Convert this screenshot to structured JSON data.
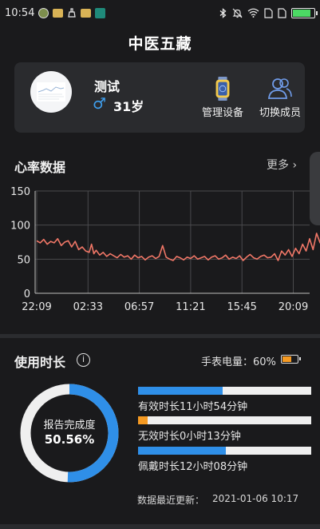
{
  "status_bar": {
    "time": "10:54",
    "battery_level": 0.85
  },
  "page_title": "中医五藏",
  "profile": {
    "name": "测试",
    "gender_symbol": "♂",
    "age": "31岁",
    "manage_device_label": "管理设备",
    "switch_member_label": "切换成员"
  },
  "heart_rate": {
    "title": "心率数据",
    "more_label": "更多"
  },
  "chart_data": {
    "type": "line",
    "title": "",
    "xlabel": "",
    "ylabel": "",
    "ylim": [
      0,
      150
    ],
    "yticks": [
      "0",
      "50",
      "100",
      "150"
    ],
    "xticks": [
      "22:09",
      "02:33",
      "06:57",
      "11:21",
      "15:45",
      "20:09"
    ],
    "grid": true,
    "series": [
      {
        "color": "#f07767",
        "x": [
          0,
          0.3,
          0.6,
          0.9,
          1.2,
          1.5,
          1.8,
          2.1,
          2.4,
          2.7,
          3.0,
          3.3,
          3.6,
          3.9,
          4.2,
          4.5,
          4.7,
          4.9,
          5.1,
          5.4,
          5.7,
          6.0,
          6.3,
          6.6,
          6.9,
          7.2,
          7.5,
          7.8,
          8.1,
          8.4,
          8.7,
          9.0,
          9.3,
          9.6,
          9.9,
          10.2,
          10.5,
          10.8,
          11.1,
          11.4,
          11.7,
          12.0,
          12.3,
          12.6,
          12.9,
          13.2,
          13.5,
          13.8,
          14.1,
          14.4,
          14.7,
          15.0,
          15.3,
          15.6,
          15.9,
          16.2,
          16.5,
          16.8,
          17.1,
          17.4,
          17.7,
          18.0,
          18.3,
          18.6,
          18.9,
          19.2,
          19.5,
          19.8,
          20.1,
          20.4,
          20.7,
          21.0,
          21.3,
          21.6,
          21.9,
          22.2,
          22.5,
          22.8,
          23.1,
          23.4,
          23.7,
          24.0,
          24.3,
          24.6,
          24.9,
          25.2,
          25.5,
          25.8,
          26.1,
          26.4,
          26.7
        ],
        "y": [
          77,
          74,
          79,
          72,
          76,
          74,
          80,
          70,
          75,
          77,
          68,
          76,
          64,
          68,
          62,
          60,
          72,
          58,
          63,
          56,
          60,
          54,
          58,
          55,
          52,
          57,
          53,
          55,
          50,
          56,
          52,
          54,
          49,
          53,
          55,
          51,
          54,
          70,
          53,
          50,
          48,
          54,
          52,
          49,
          53,
          51,
          55,
          50,
          52,
          54,
          49,
          53,
          55,
          50,
          52,
          56,
          50,
          53,
          51,
          55,
          48,
          53,
          57,
          52,
          50,
          54,
          56,
          52,
          53,
          58,
          48,
          62,
          56,
          64,
          54,
          66,
          58,
          72,
          62,
          80,
          64,
          88,
          74,
          97,
          78,
          104,
          88,
          94,
          82,
          96,
          88
        ]
      }
    ]
  },
  "usage": {
    "title": "使用时长",
    "watch_battery_label": "手表电量：60%",
    "watch_battery_level": 0.6,
    "completion_label": "报告完成度",
    "completion_value": "50.56%",
    "completion_fraction": 0.5056,
    "bars": [
      {
        "label": "有效时长11小时54分钟",
        "fraction": 0.49,
        "color": "#2f8fe8"
      },
      {
        "label": "无效时长0小时13分钟",
        "fraction": 0.055,
        "color": "#f59a23"
      },
      {
        "label": "佩戴时长12小时08分钟",
        "fraction": 0.505,
        "color": "#2f8fe8"
      }
    ],
    "update_label": "数据最近更新：",
    "update_time": "2021-01-06 10:17"
  },
  "colors": {
    "background": "#1a1a1c",
    "card": "#2a2b2e",
    "accent_blue": "#2f8fe8",
    "accent_orange": "#f59a23",
    "chart_line": "#f07767"
  }
}
